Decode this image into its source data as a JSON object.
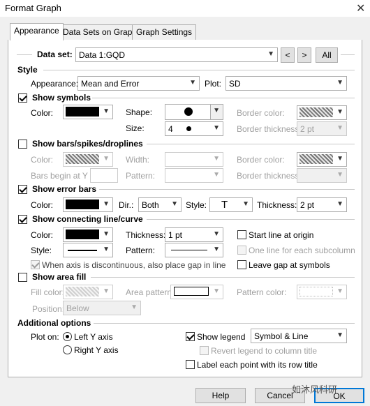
{
  "window": {
    "title": "Format Graph",
    "close_glyph": "✕"
  },
  "tabs": [
    {
      "label": "Appearance",
      "active": true
    },
    {
      "label": "Data Sets on Graph",
      "active": false
    },
    {
      "label": "Graph Settings",
      "active": false
    }
  ],
  "dataset": {
    "label": "Data set:",
    "value": "Data 1:GQD",
    "prev": "<",
    "next": ">",
    "all": "All"
  },
  "style": {
    "heading": "Style",
    "appearance_label": "Appearance:",
    "appearance_value": "Mean and Error",
    "plot_label": "Plot:",
    "plot_value": "SD"
  },
  "symbols": {
    "heading": "Show symbols",
    "checked": true,
    "color_label": "Color:",
    "color": "#000000",
    "shape_label": "Shape:",
    "shape_icon": "filled-circle",
    "size_label": "Size:",
    "size_value": "4",
    "border_color_label": "Border color:",
    "border_thickness_label": "Border thickness:",
    "border_thickness_value": "2 pt"
  },
  "bars": {
    "heading": "Show bars/spikes/droplines",
    "checked": false,
    "color_label": "Color:",
    "width_label": "Width:",
    "border_color_label": "Border color:",
    "bars_begin_label": "Bars begin at Y =",
    "pattern_label": "Pattern:",
    "border_thickness_label": "Border thickness:"
  },
  "error_bars": {
    "heading": "Show error bars",
    "checked": true,
    "color_label": "Color:",
    "color": "#000000",
    "dir_label": "Dir.:",
    "dir_value": "Both",
    "style_label": "Style:",
    "style_glyph": "T",
    "thickness_label": "Thickness:",
    "thickness_value": "2 pt"
  },
  "connecting": {
    "heading": "Show connecting line/curve",
    "checked": true,
    "color_label": "Color:",
    "color": "#000000",
    "thickness_label": "Thickness:",
    "thickness_value": "1 pt",
    "style_label": "Style:",
    "pattern_label": "Pattern:",
    "start_origin": "Start line at origin",
    "one_line": "One line for each subcolumn",
    "leave_gap": "Leave gap at symbols",
    "discontinuous": "When axis is discontinuous, also place gap in line"
  },
  "area_fill": {
    "heading": "Show area fill",
    "checked": false,
    "fill_color_label": "Fill color:",
    "area_pattern_label": "Area pattern:",
    "pattern_color_label": "Pattern color:",
    "position_label": "Position:",
    "position_value": "Below"
  },
  "additional": {
    "heading": "Additional options",
    "plot_on_label": "Plot on:",
    "left_y": "Left Y axis",
    "right_y": "Right  Y axis",
    "show_legend": "Show legend",
    "legend_value": "Symbol & Line",
    "revert_legend": "Revert legend to column title",
    "label_each": "Label each point with its row title"
  },
  "buttons": {
    "help": "Help",
    "cancel": "Cancel",
    "ok": "OK"
  },
  "watermark": "如沐风科研"
}
